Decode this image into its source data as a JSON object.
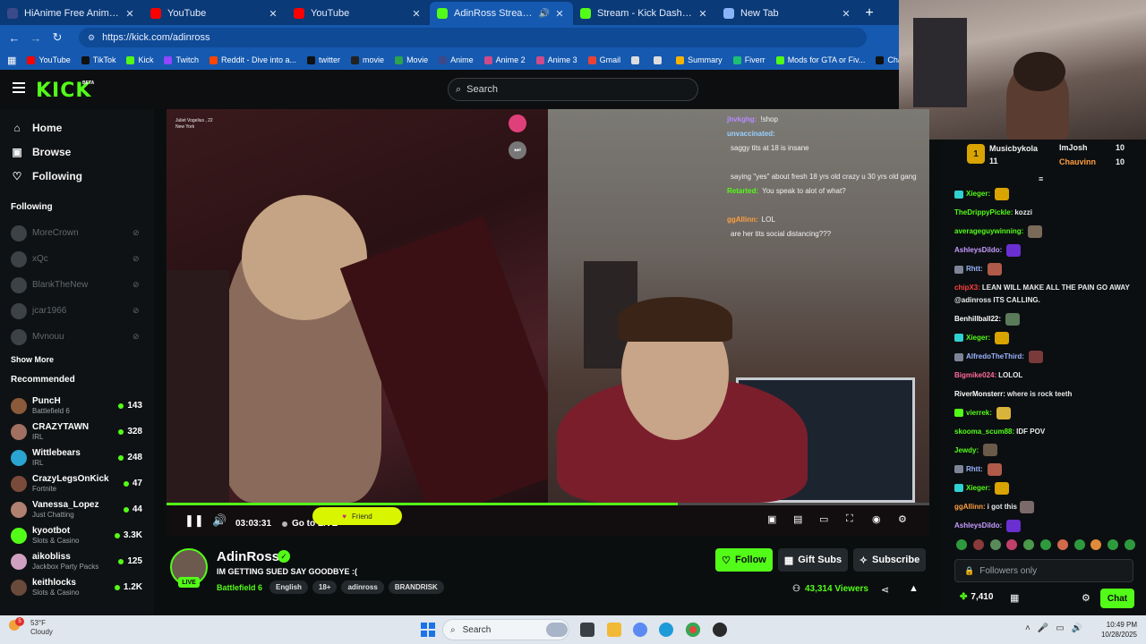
{
  "browser": {
    "tabs": [
      {
        "title": "HiAnime Free Anime Streaming",
        "icon": "hianime-icon",
        "color": "#3c4a8a",
        "active": false
      },
      {
        "title": "YouTube",
        "icon": "youtube-icon",
        "color": "#ff0000",
        "active": false
      },
      {
        "title": "YouTube",
        "icon": "youtube-icon",
        "color": "#ff0000",
        "active": false
      },
      {
        "title": "AdinRoss Stream - Watch Live",
        "icon": "kick-icon",
        "color": "#53fc18",
        "active": true
      },
      {
        "title": "Stream - Kick Dashboard",
        "icon": "kick-icon",
        "color": "#53fc18",
        "active": false
      },
      {
        "title": "New Tab",
        "icon": "chrome-icon",
        "color": "#8ab4f8",
        "active": false
      }
    ],
    "url": "https://kick.com/adinross",
    "bookmarks": [
      {
        "label": "YouTube",
        "color": "#ff0000"
      },
      {
        "label": "TikTok",
        "color": "#111111"
      },
      {
        "label": "Kick",
        "color": "#53fc18"
      },
      {
        "label": "Twitch",
        "color": "#9146ff"
      },
      {
        "label": "Reddit - Dive into a...",
        "color": "#ff4500"
      },
      {
        "label": "twitter",
        "color": "#111111"
      },
      {
        "label": "movie",
        "color": "#222222"
      },
      {
        "label": "Movie",
        "color": "#2aa44f"
      },
      {
        "label": "Anime",
        "color": "#3c4a8a"
      },
      {
        "label": "Anime 2",
        "color": "#d04a8a"
      },
      {
        "label": "Anime 3",
        "color": "#d04a8a"
      },
      {
        "label": "Gmail",
        "color": "#ea4335"
      },
      {
        "label": "",
        "color": "#dddddd"
      },
      {
        "label": "",
        "color": "#dddddd"
      },
      {
        "label": "Summary",
        "color": "#f4b400"
      },
      {
        "label": "Fiverr",
        "color": "#1dbf73"
      },
      {
        "label": "Mods for GTA or Fiv...",
        "color": "#53fc18"
      },
      {
        "label": "ChatGPT",
        "color": "#111111"
      }
    ]
  },
  "kick": {
    "logo": "KICK",
    "beta": "BETA",
    "search_placeholder": "Search",
    "nav": [
      {
        "label": "Home",
        "icon": "home-icon",
        "glyph": "⌂"
      },
      {
        "label": "Browse",
        "icon": "browse-icon",
        "glyph": "▣"
      },
      {
        "label": "Following",
        "icon": "heart-icon",
        "glyph": "♡"
      }
    ],
    "following_header": "Following",
    "following": [
      "MoreCrown",
      "xQc",
      "BlankTheNew",
      "jcar1966",
      "Mvnouu"
    ],
    "show_more": "Show More",
    "recommended_header": "Recommended",
    "recommended": [
      {
        "name": "PuncH",
        "category": "Battlefield 6",
        "viewers": "143",
        "color": "#8a5a3a"
      },
      {
        "name": "CRAZYTAWN",
        "category": "IRL",
        "viewers": "328",
        "color": "#a07060"
      },
      {
        "name": "Wittlebears",
        "category": "IRL",
        "viewers": "248",
        "color": "#2aa4d0"
      },
      {
        "name": "CrazyLegsOnKick",
        "category": "Fortnite",
        "viewers": "47",
        "color": "#7a4a3a"
      },
      {
        "name": "Vanessa_Lopez",
        "category": "Just Chatting",
        "viewers": "44",
        "color": "#b08070"
      },
      {
        "name": "kyootbot",
        "category": "Slots & Casino",
        "viewers": "3.3K",
        "color": "#53fc18"
      },
      {
        "name": "aikobliss",
        "category": "Jackbox Party Packs",
        "viewers": "125",
        "color": "#d0a0c0"
      },
      {
        "name": "keithlocks",
        "category": "Slots & Casino",
        "viewers": "1.2K",
        "color": "#6a4a3a"
      }
    ]
  },
  "player": {
    "time": "03:03:31",
    "go_live": "Go to LIVE",
    "friend_label": "Friend",
    "progress_fraction": 0.67,
    "overlay_chat": [
      {
        "user": "jhvkghg:",
        "text": "!shop",
        "color": "#b58cff"
      },
      {
        "user": "unvaccinated:",
        "text": "",
        "color": "#9ad0ff"
      },
      {
        "user": "",
        "text": "saggy tits at 18 is insane",
        "color": "#ff6a6a"
      },
      {
        "user": "",
        "text": "",
        "color": "#ff4d4d"
      },
      {
        "user": "",
        "text": "saying \"yes\" about fresh 18 yrs old crazy u 30 yrs old gang",
        "color": "#8bd0ff"
      },
      {
        "user": "Retarted:",
        "text": "You speak to alot of what?",
        "color": "#53fc18"
      },
      {
        "user": "",
        "text": "",
        "color": "#ff5b5b"
      },
      {
        "user": "ggAllinn:",
        "text": "LOL",
        "color": "#ff9f40"
      },
      {
        "user": "",
        "text": "are her tits social distancing???",
        "color": "#ffd27a"
      }
    ],
    "left_cam_caption": "Juliet Vogelius , 22\nNew York"
  },
  "channel": {
    "name": "AdinRoss",
    "live_label": "LIVE",
    "title": "IM GETTING SUED SAY GOODBYE :(",
    "category": "Battlefield 6",
    "tags": [
      "English",
      "18+",
      "adinross",
      "BRANDRISK"
    ],
    "follow": "Follow",
    "gift_subs": "Gift Subs",
    "subscribe": "Subscribe",
    "viewers": "43,314 Viewers"
  },
  "chat": {
    "leaderboard": [
      {
        "rank": "1",
        "name": "Musicbykola",
        "count": "11"
      },
      {
        "rank": "",
        "name": "ImJosh",
        "count": "10"
      },
      {
        "rank": "",
        "name": "Chauvinn",
        "count": "10"
      }
    ],
    "messages": [
      {
        "user": "Xieger:",
        "text": "",
        "color": "#53fc18",
        "badge": "#2fd1d1",
        "emote": "#d9a400"
      },
      {
        "user": "TheDrippyPickle:",
        "text": "kozzi",
        "color": "#53fc18",
        "badge": "",
        "emote": ""
      },
      {
        "user": "averageguywinning:",
        "text": "",
        "color": "#53fc18",
        "badge": "",
        "emote": "#7a6a5a"
      },
      {
        "user": "AshleysDildo:",
        "text": "",
        "color": "#c59bff",
        "badge": "",
        "emote": "#6a2fd1"
      },
      {
        "user": "Rhtt:",
        "text": "",
        "color": "#9ab4ff",
        "badge": "#7c8596",
        "emote": "#b05a4a"
      },
      {
        "user": "chipX3:",
        "text": "LEAN WILL MAKE ALL THE PAIN GO AWAY @adinross ITS CALLING.",
        "color": "#ff4040",
        "badge": "",
        "emote": ""
      },
      {
        "user": "Benhillball22:",
        "text": "",
        "color": "#ffffff",
        "badge": "",
        "emote": "#5a7a5a"
      },
      {
        "user": "Xieger:",
        "text": "",
        "color": "#53fc18",
        "badge": "#2fd1d1",
        "emote": "#d9a400"
      },
      {
        "user": "AlfredoTheThird:",
        "text": "",
        "color": "#9ab4ff",
        "badge": "#7c8596",
        "emote": "#7a3a3a"
      },
      {
        "user": "Bigmike024:",
        "text": "LOLOL",
        "color": "#ff6a9a",
        "badge": "",
        "emote": ""
      },
      {
        "user": "RiverMonsterr:",
        "text": "where is rock teeth",
        "color": "#ffffff",
        "badge": "",
        "emote": ""
      },
      {
        "user": "vierrek:",
        "text": "",
        "color": "#53fc18",
        "badge": "#53fc18",
        "emote": "#d9b43a"
      },
      {
        "user": "skooma_scum88:",
        "text": "IDF POV",
        "color": "#53fc18",
        "badge": "",
        "emote": ""
      },
      {
        "user": "Jewdy:",
        "text": "",
        "color": "#53fc18",
        "badge": "",
        "emote": "#6a5a4a"
      },
      {
        "user": "Rhtt:",
        "text": "",
        "color": "#9ab4ff",
        "badge": "#7c8596",
        "emote": "#b05a4a"
      },
      {
        "user": "Xieger:",
        "text": "",
        "color": "#53fc18",
        "badge": "#2fd1d1",
        "emote": "#d9a400"
      },
      {
        "user": "ggAllinn:",
        "text": "i got this",
        "color": "#ff9f40",
        "badge": "",
        "emote": "#7a6a6a"
      },
      {
        "user": "AshleysDildo:",
        "text": "",
        "color": "#c59bff",
        "badge": "",
        "emote": "#6a2fd1"
      }
    ],
    "input_placeholder": "Followers only",
    "points": "7,410",
    "chat_button": "Chat"
  },
  "taskbar": {
    "weather_temp": "53°F",
    "weather_desc": "Cloudy",
    "weather_badge": "5",
    "search": "Search",
    "time": "10:49 PM",
    "date": "10/28/2025"
  }
}
